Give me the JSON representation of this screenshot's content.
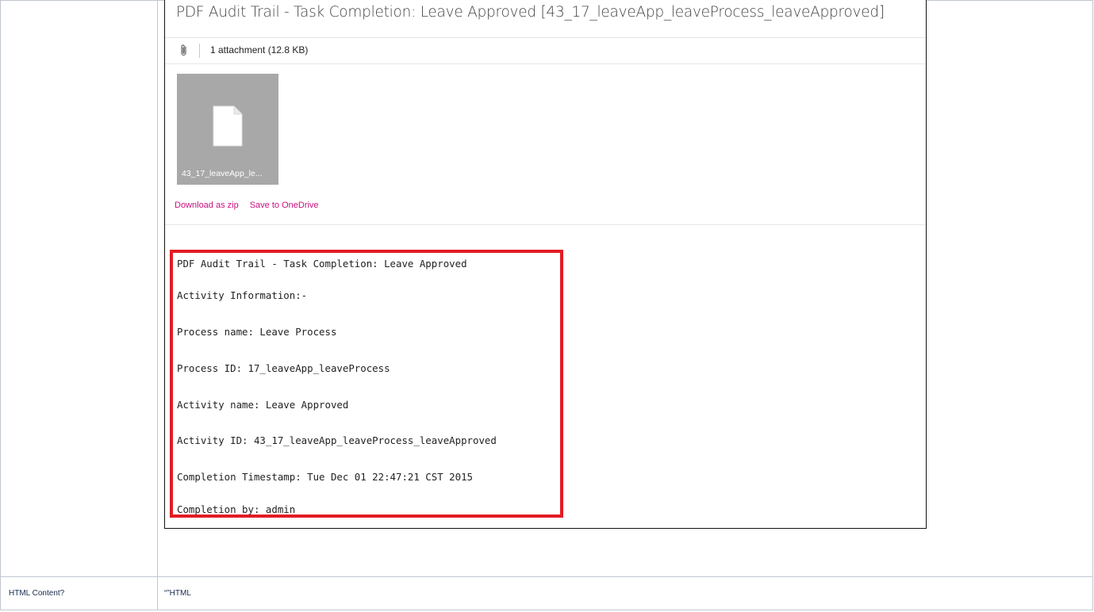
{
  "email": {
    "subject": "PDF Audit Trail - Task Completion: Leave Approved [43_17_leaveApp_leaveProcess_leaveApproved]",
    "attachments_label": "1 attachment (12.8 KB)",
    "attachment_filename": "43_17_leaveApp_le...",
    "download_zip": "Download as zip",
    "save_onedrive": "Save to OneDrive",
    "body_lines": [
      "PDF Audit Trail - Task Completion: Leave Approved",
      "Activity Information:-",
      "Process name: Leave Process",
      "Process ID: 17_leaveApp_leaveProcess",
      "Activity name: Leave Approved",
      "Activity ID: 43_17_leaveApp_leaveProcess_leaveApproved",
      "Completion Timestamp: Tue Dec 01 22:47:21 CST 2015",
      "Completion by: admin"
    ]
  },
  "table": {
    "row2_label": "HTML Content?",
    "row2_value": "“”HTML"
  },
  "colors": {
    "link": "#c7107f",
    "highlight_border": "#e31b23",
    "table_border": "#c1c7d0"
  }
}
